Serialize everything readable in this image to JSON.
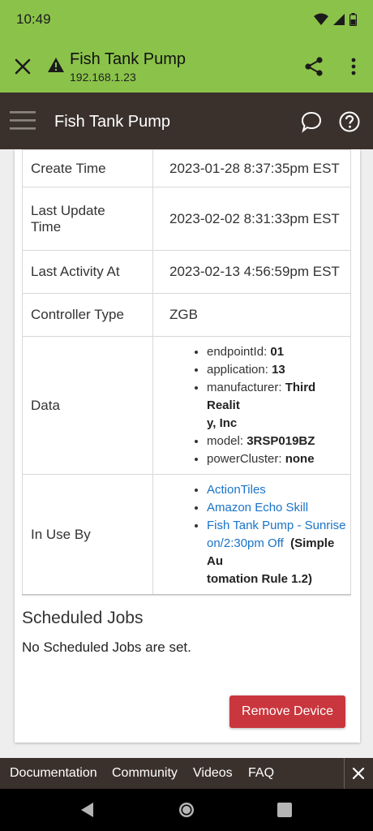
{
  "status_bar": {
    "time": "10:49"
  },
  "browser": {
    "title": "Fish Tank Pump",
    "url": "192.168.1.23"
  },
  "app_bar": {
    "title": "Fish Tank Pump"
  },
  "details": {
    "create_time": {
      "label": "Create Time",
      "value": "2023-01-28 8:37:35pm EST"
    },
    "last_update": {
      "label_line1": "Last Update",
      "label_line2": "Time",
      "value": "2023-02-02 8:31:33pm EST"
    },
    "last_activity": {
      "label": "Last Activity At",
      "value": "2023-02-13 4:56:59pm EST"
    },
    "controller_type": {
      "label": "Controller Type",
      "value": "ZGB"
    },
    "data": {
      "label": "Data",
      "items": [
        {
          "key": "endpointId:",
          "value": "01"
        },
        {
          "key": "application:",
          "value": "13"
        },
        {
          "key": "manufacturer:",
          "value_line1": "Third Realit",
          "value_line2": "y, Inc"
        },
        {
          "key": "model:",
          "value": "3RSP019BZ"
        },
        {
          "key": "powerCluster:",
          "value": "none"
        }
      ]
    },
    "in_use_by": {
      "label": "In Use By",
      "links": [
        "ActionTiles",
        "Amazon Echo Skill"
      ],
      "rule": {
        "link_line1": "Fish Tank Pump - Sunrise",
        "link_line2": "on/2:30pm Off",
        "suffix_line1": "(Simple Au",
        "suffix_line2": "tomation Rule 1.2)"
      }
    }
  },
  "scheduled_jobs": {
    "title": "Scheduled Jobs",
    "message": "No Scheduled Jobs are set."
  },
  "actions": {
    "remove_device": "Remove Device"
  },
  "footer_links": [
    "Documentation",
    "Community",
    "Videos",
    "FAQ"
  ],
  "colors": {
    "browser_bar": "#8bc34a",
    "app_bar": "#3a312d",
    "link": "#1a73c8",
    "danger_button": "#c9363d"
  },
  "icons": {
    "browser": [
      "close-icon",
      "warning-icon",
      "share-icon",
      "more-vert-icon"
    ],
    "app_bar": [
      "hamburger-menu-icon",
      "chat-bubble-icon",
      "help-icon"
    ],
    "status": [
      "wifi-icon",
      "signal-icon",
      "battery-icon"
    ],
    "nav": [
      "back-icon",
      "home-icon",
      "recents-icon"
    ]
  }
}
